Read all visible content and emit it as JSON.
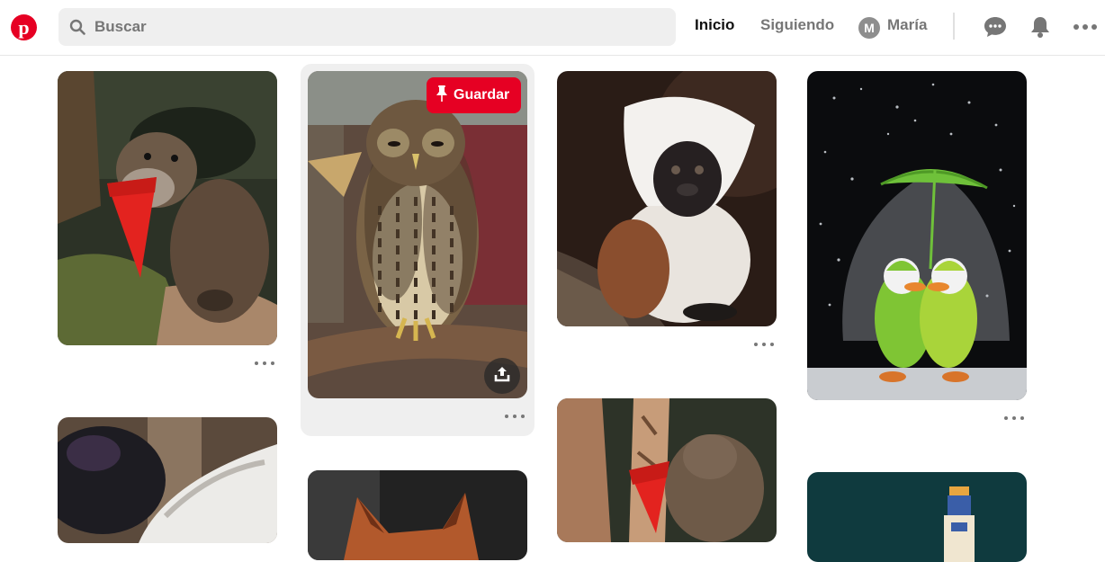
{
  "header": {
    "search_placeholder": "Buscar",
    "nav_home": "Inicio",
    "nav_following": "Siguiendo",
    "user_initial": "M",
    "user_name": "María"
  },
  "pins": [
    {
      "name": "otter-ice-cream"
    },
    {
      "name": "owl-on-branch"
    },
    {
      "name": "cotton-top-tamarin"
    },
    {
      "name": "ducks-umbrella-snow"
    },
    {
      "name": "bird-black-white"
    },
    {
      "name": "fox"
    },
    {
      "name": "otter-red-cup"
    },
    {
      "name": "bottle"
    }
  ],
  "hover_pin": {
    "save_label": "Guardar"
  },
  "colors": {
    "brand": "#e60023",
    "search_bg": "#efefef",
    "text_muted": "#767676"
  }
}
